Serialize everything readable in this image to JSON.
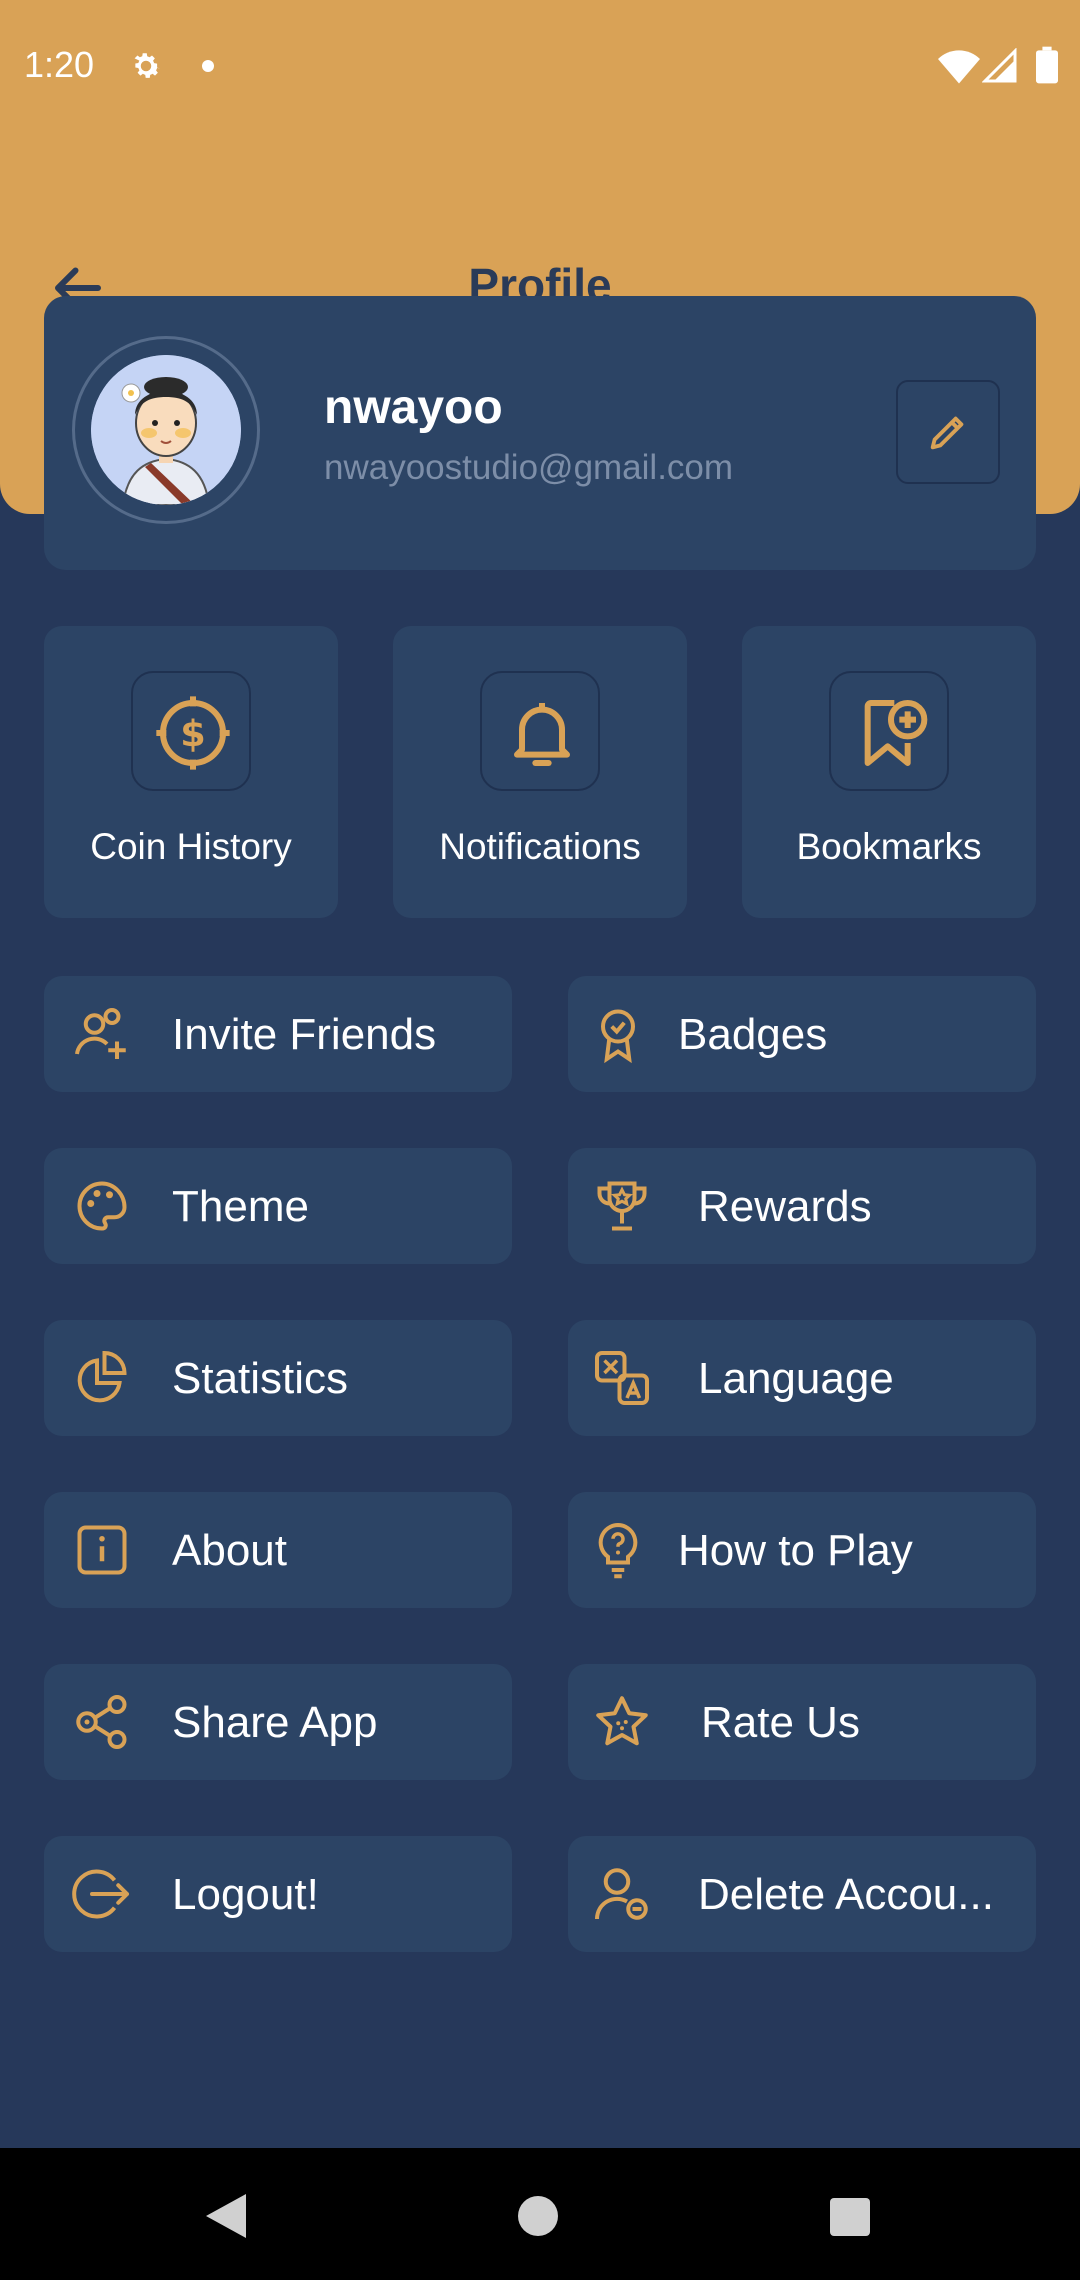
{
  "status_bar": {
    "time": "1:20"
  },
  "app_bar": {
    "title": "Profile"
  },
  "profile": {
    "name": "nwayoo",
    "email": "nwayoostudio@gmail.com"
  },
  "tiles": [
    {
      "label": "Coin History",
      "icon": "coin-icon"
    },
    {
      "label": "Notifications",
      "icon": "bell-icon"
    },
    {
      "label": "Bookmarks",
      "icon": "bookmark-add-icon"
    }
  ],
  "menu": [
    {
      "label": "Invite Friends",
      "icon": "invite-friends-icon"
    },
    {
      "label": "Badges",
      "icon": "badge-icon"
    },
    {
      "label": "Theme",
      "icon": "palette-icon"
    },
    {
      "label": "Rewards",
      "icon": "trophy-icon"
    },
    {
      "label": "Statistics",
      "icon": "pie-chart-icon"
    },
    {
      "label": "Language",
      "icon": "translate-icon"
    },
    {
      "label": "About",
      "icon": "info-icon"
    },
    {
      "label": "How to Play",
      "icon": "question-bulb-icon"
    },
    {
      "label": "Share App",
      "icon": "share-icon"
    },
    {
      "label": "Rate Us",
      "icon": "star-icon"
    },
    {
      "label": "Logout!",
      "icon": "logout-icon"
    },
    {
      "label": "Delete Accou...",
      "icon": "delete-user-icon"
    }
  ],
  "colors": {
    "accent": "#d9a256",
    "background": "#26385a",
    "card": "#2c4465",
    "muted_text": "#7d8ea8"
  }
}
